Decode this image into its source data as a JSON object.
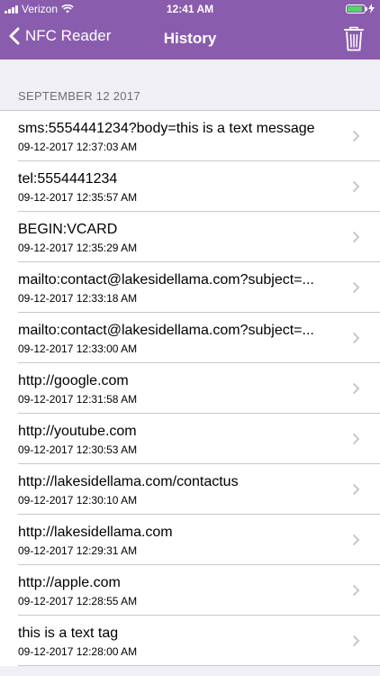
{
  "status_bar": {
    "carrier": "Verizon",
    "time": "12:41 AM",
    "battery_percent": 0.9
  },
  "nav": {
    "back_label": "NFC Reader",
    "title": "History",
    "icons": {
      "back": "chevron-left-icon",
      "trash": "trash-icon"
    }
  },
  "section": {
    "header": "SEPTEMBER 12 2017"
  },
  "history": [
    {
      "title": "sms:5554441234?body=this is a text message",
      "date": "09-12-2017 12:37:03 AM"
    },
    {
      "title": "tel:5554441234",
      "date": "09-12-2017 12:35:57 AM"
    },
    {
      "title": "BEGIN:VCARD",
      "date": "09-12-2017 12:35:29 AM"
    },
    {
      "title": "mailto:contact@lakesidellama.com?subject=...",
      "date": "09-12-2017 12:33:18 AM"
    },
    {
      "title": "mailto:contact@lakesidellama.com?subject=...",
      "date": "09-12-2017 12:33:00 AM"
    },
    {
      "title": "http://google.com",
      "date": "09-12-2017 12:31:58 AM"
    },
    {
      "title": "http://youtube.com",
      "date": "09-12-2017 12:30:53 AM"
    },
    {
      "title": "http://lakesidellama.com/contactus",
      "date": "09-12-2017 12:30:10 AM"
    },
    {
      "title": "http://lakesidellama.com",
      "date": "09-12-2017 12:29:31 AM"
    },
    {
      "title": "http://apple.com",
      "date": "09-12-2017 12:28:55 AM"
    },
    {
      "title": "this is a text tag",
      "date": "09-12-2017 12:28:00 AM"
    }
  ],
  "colors": {
    "header": "#8a5cad",
    "background": "#efeff4",
    "battery": "#4cd964"
  }
}
